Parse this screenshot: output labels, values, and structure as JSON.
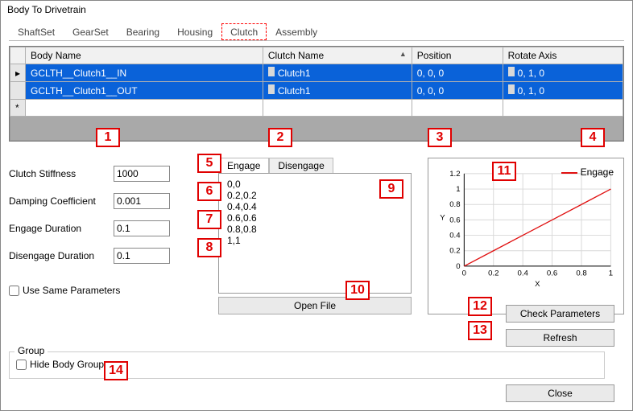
{
  "window": {
    "title": "Body To Drivetrain"
  },
  "tabs": [
    "ShaftSet",
    "GearSet",
    "Bearing",
    "Housing",
    "Clutch",
    "Assembly"
  ],
  "activeTabIndex": 4,
  "grid": {
    "headers": [
      "",
      "Body Name",
      "Clutch Name",
      "Position",
      "Rotate Axis"
    ],
    "rows": [
      {
        "marker": "▸",
        "body": "GCLTH__Clutch1__IN",
        "clutch": "Clutch1",
        "pos": "0, 0, 0",
        "axis": "0, 1, 0"
      },
      {
        "marker": "",
        "body": "GCLTH__Clutch1__OUT",
        "clutch": "Clutch1",
        "pos": "0, 0, 0",
        "axis": "0, 1, 0"
      }
    ],
    "newrow_marker": "*"
  },
  "params": {
    "clutch_stiffness": {
      "label": "Clutch Stiffness",
      "value": "1000"
    },
    "damping_coeff": {
      "label": "Damping Coefficient",
      "value": "0.001"
    },
    "engage_dur": {
      "label": "Engage Duration",
      "value": "0.1"
    },
    "disengage_dur": {
      "label": "Disengage Duration",
      "value": "0.1"
    },
    "use_same_label": "Use Same Parameters"
  },
  "subtabs": {
    "engage": "Engage",
    "disengage": "Disengage",
    "activeIndex": 0
  },
  "curve_points": [
    "0,0",
    "0.2,0.2",
    "0.4,0.4",
    "0.6,0.6",
    "0.8,0.8",
    "1,1"
  ],
  "openfile_label": "Open File",
  "chart_data": {
    "type": "line",
    "title": "",
    "xlabel": "X",
    "ylabel": "Y",
    "xlim": [
      0,
      1
    ],
    "ylim": [
      0,
      1.2
    ],
    "xticks": [
      0,
      0.2,
      0.4,
      0.6,
      0.8,
      1
    ],
    "yticks": [
      0,
      0.2,
      0.4,
      0.6,
      0.8,
      1.0,
      1.2
    ],
    "series": [
      {
        "name": "Engage",
        "x": [
          0,
          0.2,
          0.4,
          0.6,
          0.8,
          1
        ],
        "y": [
          0,
          0.2,
          0.4,
          0.6,
          0.8,
          1
        ]
      }
    ]
  },
  "buttons": {
    "check": "Check Parameters",
    "refresh": "Refresh",
    "close": "Close"
  },
  "group": {
    "title": "Group",
    "hide_label": "Hide Body Group"
  },
  "callouts": {
    "1": "1",
    "2": "2",
    "3": "3",
    "4": "4",
    "5": "5",
    "6": "6",
    "7": "7",
    "8": "8",
    "9": "9",
    "10": "10",
    "11": "11",
    "12": "12",
    "13": "13",
    "14": "14"
  }
}
